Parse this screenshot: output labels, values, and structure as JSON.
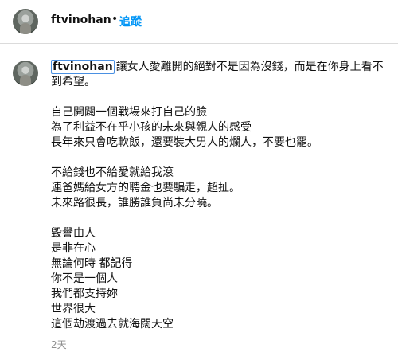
{
  "header": {
    "username": "ftvinohan",
    "separator": "•",
    "follow_label": "追蹤"
  },
  "comment": {
    "username": "ftvinohan",
    "first_text": "讓女人愛離開的絕對不是因為沒錢，而是在你身上看不到希望。",
    "paragraphs": [
      [
        "自己開闢一個戰場來打自己的臉",
        "為了利益不在乎小孩的未來與親人的感受",
        "長年來只會吃軟飯，還要裝大男人的爛人，不要也罷。"
      ],
      [
        "不給錢也不給愛就給我滾",
        "連爸媽給女方的聘金也要騙走，超扯。",
        "未來路很長，誰勝誰負尚未分曉。"
      ],
      [
        "毀譽由人",
        "是非在心",
        "無論何時 都記得",
        "你不是一個人",
        "我們都支持妳",
        "世界很大",
        "這個劫渡過去就海闊天空"
      ]
    ],
    "timestamp": "2天"
  },
  "colors": {
    "accent": "#0095f6",
    "text": "#111111",
    "muted": "#8e8e8e",
    "divider": "#dbdbdb"
  }
}
